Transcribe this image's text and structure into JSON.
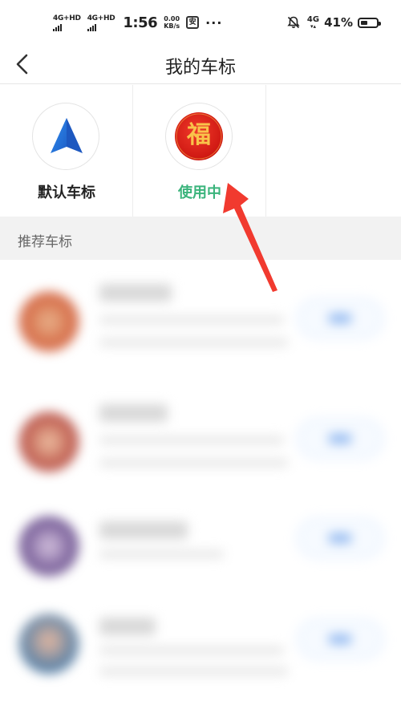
{
  "status_bar": {
    "sim1": "4G+HD",
    "sim2": "4G+HD",
    "time": "1:56",
    "speed_value": "0.00",
    "speed_unit": "KB/s",
    "app_glyph": "安",
    "more": "···",
    "net_type": "4G",
    "battery_percent": "41%"
  },
  "header": {
    "title": "我的车标"
  },
  "current_markers": [
    {
      "label": "默认车标",
      "icon": "navigation-arrow-icon",
      "active": false
    },
    {
      "label": "使用中",
      "icon": "fu-blessing-icon",
      "glyph": "福",
      "active": true
    }
  ],
  "section": {
    "title": "推荐车标"
  },
  "colors": {
    "accent_green": "#3bb47c",
    "arrow_blue": "#2f7fe0",
    "fu_red": "#e2231a",
    "annotation_red": "#f13a2f"
  }
}
